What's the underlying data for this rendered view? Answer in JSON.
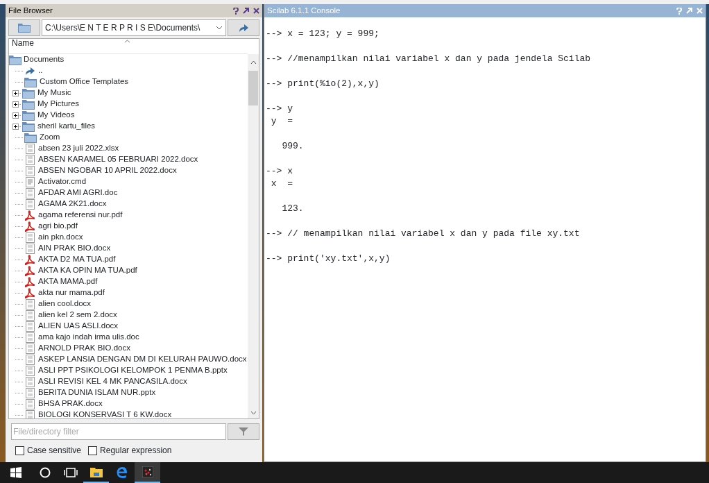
{
  "file_browser": {
    "title": "File Browser",
    "path": "C:\\Users\\E N T E R P R I S E\\Documents\\",
    "column": "Name",
    "root": "Documents",
    "items": [
      {
        "kind": "up",
        "label": "..",
        "expandable": false
      },
      {
        "kind": "folder",
        "label": "Custom Office Templates",
        "expandable": false
      },
      {
        "kind": "folder",
        "label": "My Music",
        "expandable": true
      },
      {
        "kind": "folder",
        "label": "My Pictures",
        "expandable": true
      },
      {
        "kind": "folder",
        "label": "My Videos",
        "expandable": true
      },
      {
        "kind": "folder",
        "label": "sheril kartu_files",
        "expandable": true
      },
      {
        "kind": "folder",
        "label": "Zoom",
        "expandable": false
      },
      {
        "kind": "binary",
        "label": "absen 23 juli 2022.xlsx",
        "expandable": false
      },
      {
        "kind": "binary",
        "label": "ABSEN KARAMEL 05 FEBRUARI 2022.docx",
        "expandable": false
      },
      {
        "kind": "binary",
        "label": "ABSEN NGOBAR 10 APRIL 2022.docx",
        "expandable": false
      },
      {
        "kind": "text",
        "label": "Activator.cmd",
        "expandable": false
      },
      {
        "kind": "binary",
        "label": "AFDAR AMI AGRI.doc",
        "expandable": false
      },
      {
        "kind": "binary",
        "label": "AGAMA 2K21.docx",
        "expandable": false
      },
      {
        "kind": "pdf",
        "label": "agama referensi nur.pdf",
        "expandable": false
      },
      {
        "kind": "pdf",
        "label": "agri bio.pdf",
        "expandable": false
      },
      {
        "kind": "binary",
        "label": "ain pkn.docx",
        "expandable": false
      },
      {
        "kind": "binary",
        "label": "AIN PRAK BIO.docx",
        "expandable": false
      },
      {
        "kind": "pdf",
        "label": "AKTA D2 MA TUA.pdf",
        "expandable": false
      },
      {
        "kind": "pdf",
        "label": "AKTA KA OPIN MA TUA.pdf",
        "expandable": false
      },
      {
        "kind": "pdf",
        "label": "AKTA MAMA.pdf",
        "expandable": false
      },
      {
        "kind": "pdf",
        "label": "akta nur mama.pdf",
        "expandable": false
      },
      {
        "kind": "binary",
        "label": "alien cool.docx",
        "expandable": false
      },
      {
        "kind": "binary",
        "label": "alien kel 2 sem 2.docx",
        "expandable": false
      },
      {
        "kind": "binary",
        "label": "ALIEN UAS ASLI.docx",
        "expandable": false
      },
      {
        "kind": "binary",
        "label": "ama kajo indah irma ulis.doc",
        "expandable": false
      },
      {
        "kind": "binary",
        "label": "ARNOLD PRAK BIO.docx",
        "expandable": false
      },
      {
        "kind": "binary",
        "label": "ASKEP LANSIA DENGAN DM DI KELURAH PAUWO.docx",
        "expandable": false
      },
      {
        "kind": "binary",
        "label": "ASLI PPT PSIKOLOGI KELOMPOK 1 PENMA B.pptx",
        "expandable": false
      },
      {
        "kind": "binary",
        "label": "ASLI REVISI KEL 4 MK PANCASILA.docx",
        "expandable": false
      },
      {
        "kind": "binary",
        "label": "BERITA DUNIA ISLAM  NUR.pptx",
        "expandable": false
      },
      {
        "kind": "binary",
        "label": "BHSA PRAK.docx",
        "expandable": false
      },
      {
        "kind": "binary",
        "label": "BIOLOGI KONSERVASI T 6 KW.docx",
        "expandable": false
      }
    ],
    "filter": {
      "placeholder": "File/directory filter"
    },
    "options": [
      {
        "label": "Case sensitive",
        "checked": false
      },
      {
        "label": "Regular expression",
        "checked": false
      }
    ]
  },
  "console": {
    "title": "Scilab 6.1.1 Console",
    "lines": [
      {
        "kind": "prompt",
        "text": "--> x = 123; y = 999;"
      },
      {
        "kind": "prompt",
        "text": "--> //menampilkan nilai variabel x dan y pada jendela Scilab"
      },
      {
        "kind": "prompt",
        "text": "--> print(%io(2),x,y)"
      },
      {
        "kind": "prompt",
        "text": "--> y"
      },
      {
        "kind": "label",
        "text": " y  ="
      },
      {
        "kind": "value",
        "text": "   999."
      },
      {
        "kind": "prompt",
        "text": "--> x"
      },
      {
        "kind": "label",
        "text": " x  ="
      },
      {
        "kind": "value",
        "text": "   123."
      },
      {
        "kind": "prompt",
        "text": "--> // menampilkan nilai variabel x dan y pada file xy.txt"
      },
      {
        "kind": "prompt",
        "text": "--> print('xy.txt',x,y)"
      }
    ]
  }
}
